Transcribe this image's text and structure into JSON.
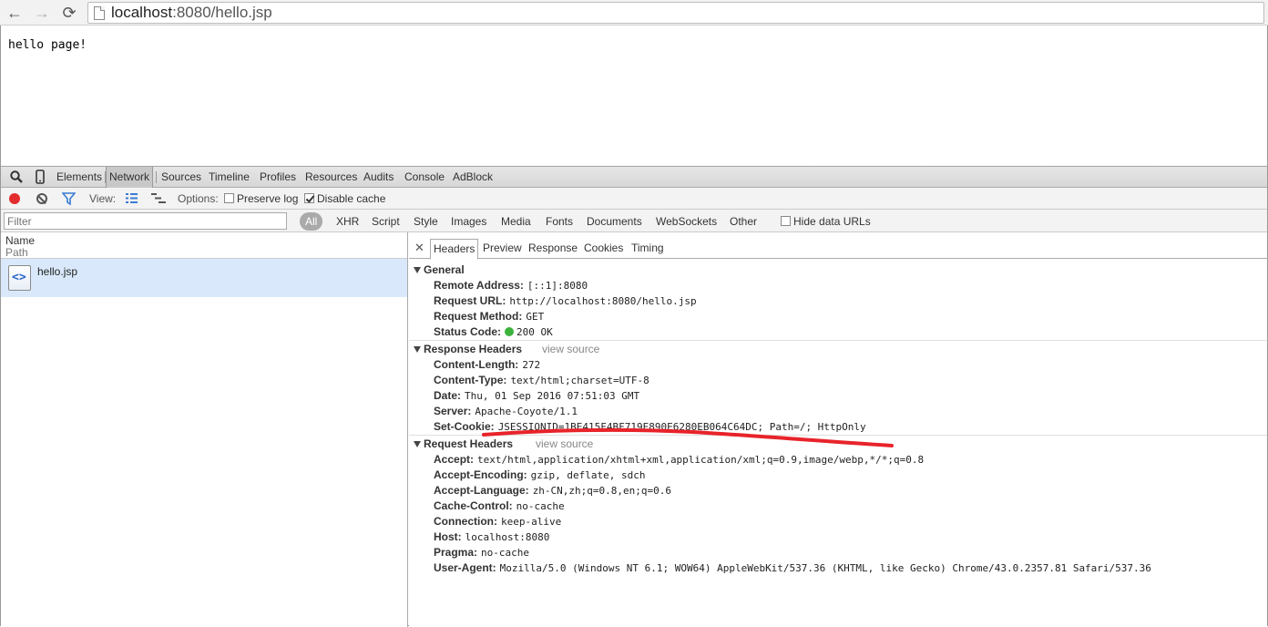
{
  "browser": {
    "url_host": "localhost",
    "url_rest": ":8080/hello.jsp"
  },
  "page": {
    "text": "hello page!"
  },
  "devtools": {
    "tabs": [
      "Elements",
      "Network",
      "Sources",
      "Timeline",
      "Profiles",
      "Resources",
      "Audits",
      "Console",
      "AdBlock"
    ],
    "selected_tab": "Network",
    "toolbar": {
      "view_label": "View:",
      "options_label": "Options:",
      "preserve_log": "Preserve log",
      "disable_cache": "Disable cache"
    },
    "filter": {
      "placeholder": "Filter",
      "types": [
        "All",
        "XHR",
        "Script",
        "Style",
        "Images",
        "Media",
        "Fonts",
        "Documents",
        "WebSockets",
        "Other"
      ],
      "hide_data_urls": "Hide data URLs"
    },
    "columns": {
      "name": "Name",
      "path": "Path"
    },
    "requests": [
      {
        "name": "hello.jsp"
      }
    ],
    "detail_tabs": [
      "Headers",
      "Preview",
      "Response",
      "Cookies",
      "Timing"
    ],
    "general": {
      "title": "General",
      "rows": [
        {
          "k": "Remote Address:",
          "v": "[::1]:8080"
        },
        {
          "k": "Request URL:",
          "v": "http://localhost:8080/hello.jsp"
        },
        {
          "k": "Request Method:",
          "v": "GET"
        },
        {
          "k": "Status Code:",
          "v": "200 OK"
        }
      ]
    },
    "response_headers": {
      "title": "Response Headers",
      "view_source": "view source",
      "rows": [
        {
          "k": "Content-Length:",
          "v": "272"
        },
        {
          "k": "Content-Type:",
          "v": "text/html;charset=UTF-8"
        },
        {
          "k": "Date:",
          "v": "Thu, 01 Sep 2016 07:51:03 GMT"
        },
        {
          "k": "Server:",
          "v": "Apache-Coyote/1.1"
        },
        {
          "k": "Set-Cookie:",
          "v": "JSESSIONID=1BE415F4BF719E890E6280EB064C64DC; Path=/; HttpOnly"
        }
      ]
    },
    "request_headers": {
      "title": "Request Headers",
      "view_source": "view source",
      "rows": [
        {
          "k": "Accept:",
          "v": "text/html,application/xhtml+xml,application/xml;q=0.9,image/webp,*/*;q=0.8"
        },
        {
          "k": "Accept-Encoding:",
          "v": "gzip, deflate, sdch"
        },
        {
          "k": "Accept-Language:",
          "v": "zh-CN,zh;q=0.8,en;q=0.6"
        },
        {
          "k": "Cache-Control:",
          "v": "no-cache"
        },
        {
          "k": "Connection:",
          "v": "keep-alive"
        },
        {
          "k": "Host:",
          "v": "localhost:8080"
        },
        {
          "k": "Pragma:",
          "v": "no-cache"
        },
        {
          "k": "User-Agent:",
          "v": "Mozilla/5.0 (Windows NT 6.1; WOW64) AppleWebKit/537.36 (KHTML, like Gecko) Chrome/43.0.2357.81 Safari/537.36"
        }
      ]
    }
  },
  "colors": {
    "annotation": "#e8232a",
    "record": "#e32d2d",
    "status_ok": "#3bb33b",
    "selected_row": "#d9e9fb"
  }
}
